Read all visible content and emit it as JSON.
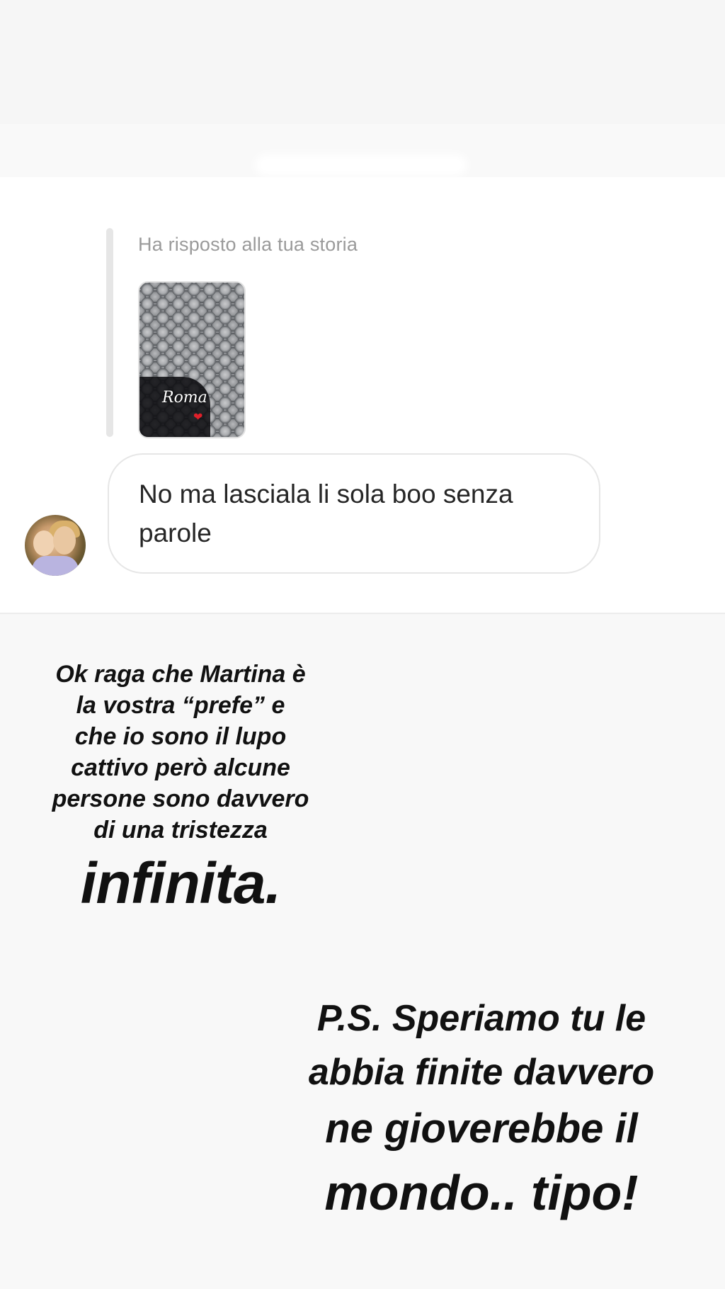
{
  "reply_context": {
    "label": "Ha risposto alla tua storia",
    "story_thumbnail": {
      "overlay_text": "Roma",
      "heart": "❤"
    }
  },
  "message": {
    "text": "No ma lasciala li sola boo senza parole"
  },
  "story_caption_left": {
    "lines": [
      "Ok raga che Martina è",
      "la vostra “prefe” e",
      "che io sono il lupo",
      "cattivo però alcune",
      "persone sono davvero",
      "di una tristezza"
    ],
    "emphasis": "infinita."
  },
  "story_caption_right": {
    "lines": [
      "P.S. Speriamo tu le",
      "abbia finite davvero",
      "ne gioverebbe il",
      "mondo.. tipo!"
    ]
  },
  "colors": {
    "background": "#f8f8f8",
    "chat_background": "#ffffff",
    "meta_text": "#9a9a9a",
    "message_text": "#262626",
    "caption_text": "#111111"
  }
}
